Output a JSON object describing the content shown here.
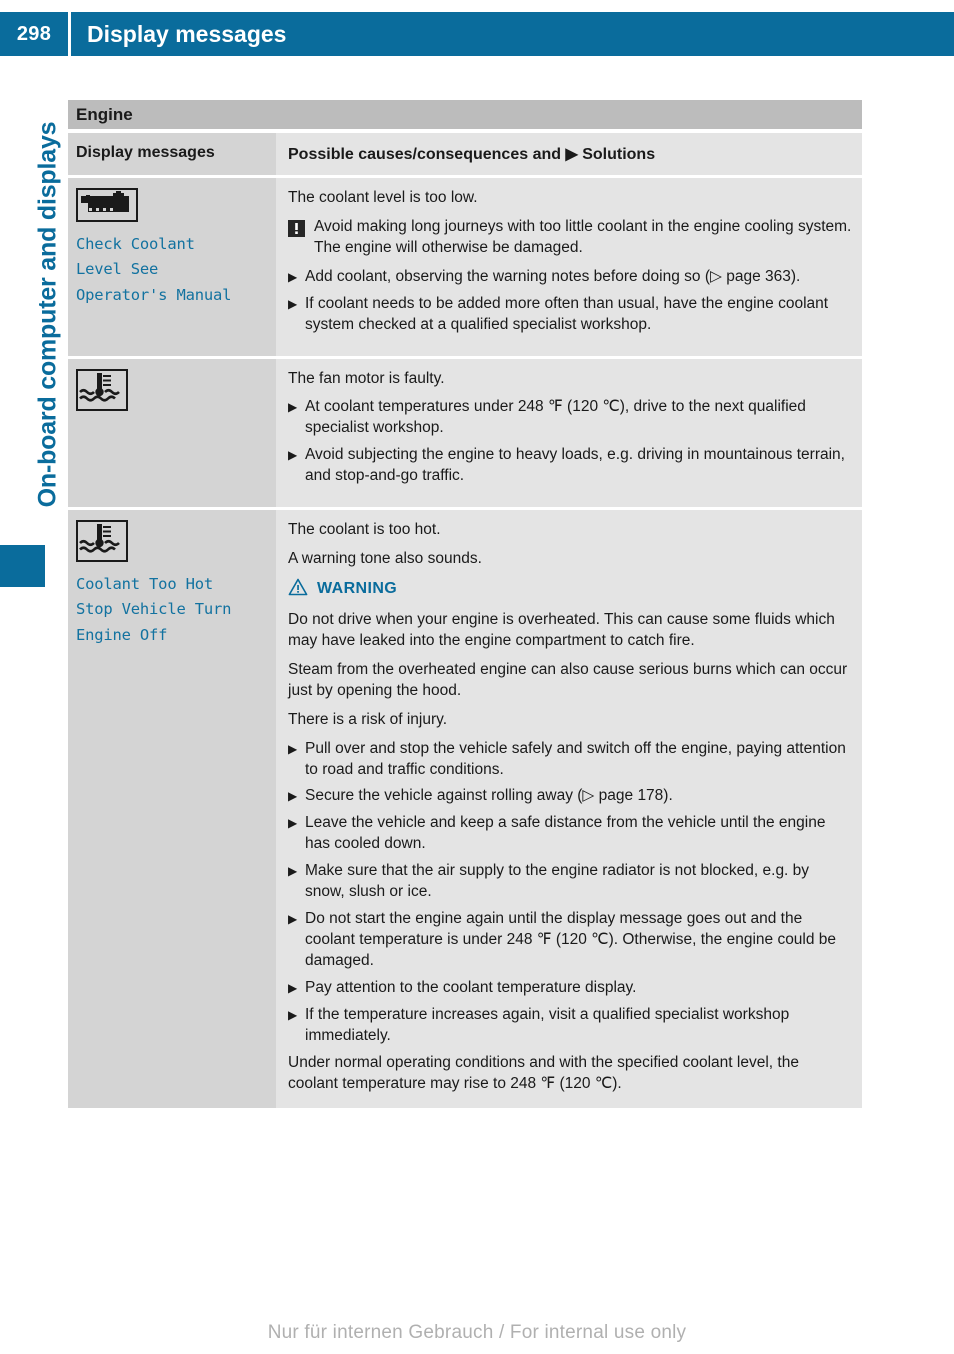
{
  "header": {
    "page_number": "298",
    "title": "Display messages"
  },
  "side_tab": {
    "label": "On-board computer and displays",
    "accent_color": "#0a6c9c"
  },
  "table": {
    "section_title": "Engine",
    "columns": {
      "left": "Display messages",
      "right": "Possible causes/consequences and ▶ Solutions"
    },
    "rows": [
      {
        "icon": "coolant-reservoir-icon",
        "message_lines": [
          "Check Coolant",
          "Level See",
          "Operator's Manual"
        ],
        "blocks": [
          {
            "type": "para",
            "text": "The coolant level is too low."
          },
          {
            "type": "note",
            "icon": "exclamation-box-icon",
            "text": "Avoid making long journeys with too little coolant in the engine cooling system. The engine will otherwise be damaged."
          },
          {
            "type": "bullet",
            "text": "Add coolant, observing the warning notes before doing so (▷ page 363)."
          },
          {
            "type": "bullet",
            "text": "If coolant needs to be added more often than usual, have the engine coolant system checked at a qualified specialist workshop."
          }
        ]
      },
      {
        "icon": "coolant-temperature-icon",
        "message_lines": [],
        "blocks": [
          {
            "type": "para",
            "text": "The fan motor is faulty."
          },
          {
            "type": "bullet",
            "text": "At coolant temperatures under 248 ℉ (120 ℃), drive to the next qualified specialist workshop."
          },
          {
            "type": "bullet",
            "text": "Avoid subjecting the engine to heavy loads, e.g. driving in mountainous terrain, and stop-and-go traffic."
          }
        ]
      },
      {
        "icon": "coolant-temperature-icon",
        "message_lines": [
          "Coolant Too Hot",
          "Stop Vehicle Turn",
          "Engine Off"
        ],
        "blocks": [
          {
            "type": "para",
            "text": "The coolant is too hot."
          },
          {
            "type": "para",
            "text": "A warning tone also sounds."
          },
          {
            "type": "warning-head",
            "text": "WARNING"
          },
          {
            "type": "para",
            "text": "Do not drive when your engine is overheated. This can cause some fluids which may have leaked into the engine compartment to catch fire."
          },
          {
            "type": "para",
            "text": "Steam from the overheated engine can also cause serious burns which can occur just by opening the hood."
          },
          {
            "type": "para",
            "text": "There is a risk of injury."
          },
          {
            "type": "bullet",
            "text": "Pull over and stop the vehicle safely and switch off the engine, paying attention to road and traffic conditions."
          },
          {
            "type": "bullet",
            "text": "Secure the vehicle against rolling away (▷ page 178)."
          },
          {
            "type": "bullet",
            "text": "Leave the vehicle and keep a safe distance from the vehicle until the engine has cooled down."
          },
          {
            "type": "bullet",
            "text": "Make sure that the air supply to the engine radiator is not blocked, e.g. by snow, slush or ice."
          },
          {
            "type": "bullet",
            "text": "Do not start the engine again until the display message goes out and the coolant temperature is under 248 ℉ (120 ℃). Otherwise, the engine could be damaged."
          },
          {
            "type": "bullet",
            "text": "Pay attention to the coolant temperature display."
          },
          {
            "type": "bullet",
            "text": "If the temperature increases again, visit a qualified specialist workshop immediately."
          },
          {
            "type": "para",
            "text": "Under normal operating conditions and with the specified coolant level, the coolant temperature may rise to 248 ℉ (120 ℃)."
          }
        ]
      }
    ]
  },
  "footer": {
    "note": "Nur für internen Gebrauch / For internal use only"
  }
}
